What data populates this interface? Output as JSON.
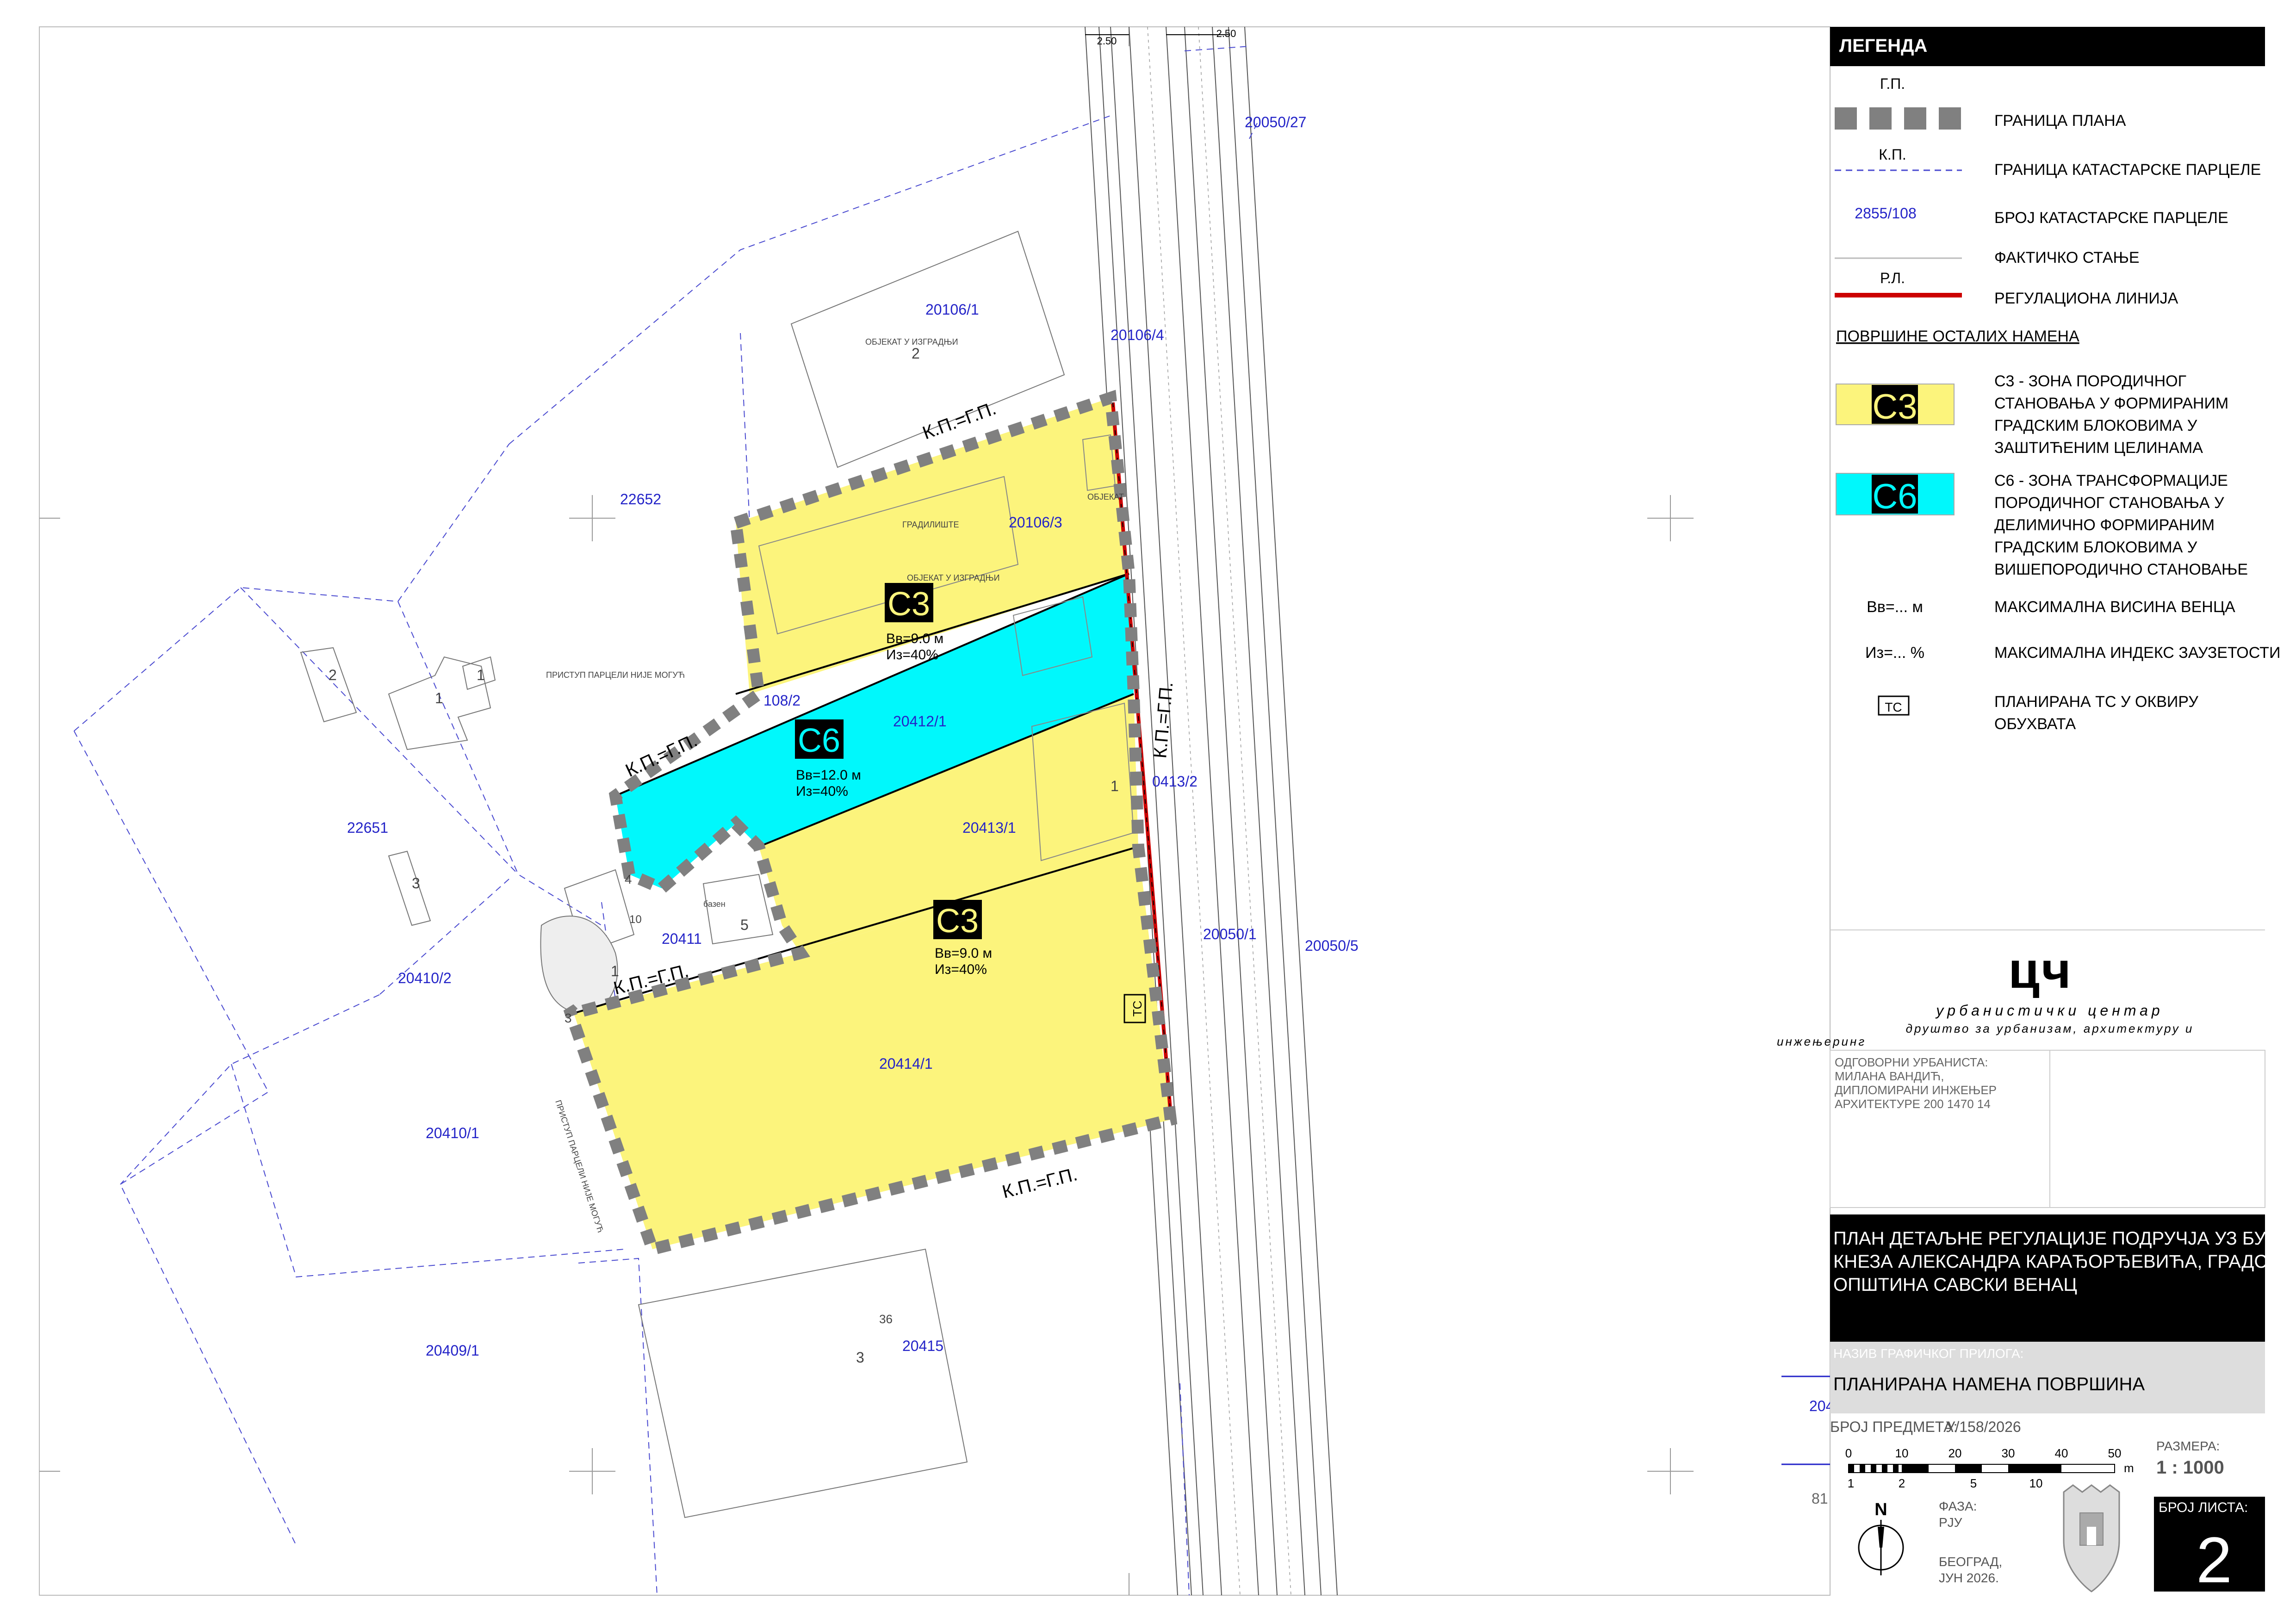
{
  "map": {
    "parcels": [
      {
        "id": "p1",
        "label": "20050/27"
      },
      {
        "id": "p2",
        "label": "20106/1"
      },
      {
        "id": "p3",
        "label": "20106/4"
      },
      {
        "id": "p4",
        "label": "22652"
      },
      {
        "id": "p5",
        "label": "20106/3"
      },
      {
        "id": "p6",
        "label": "108/2"
      },
      {
        "id": "p7",
        "label": "20412/1"
      },
      {
        "id": "p8",
        "label": "0413/2"
      },
      {
        "id": "p9",
        "label": "20413/1"
      },
      {
        "id": "p10",
        "label": "22651"
      },
      {
        "id": "p11",
        "label": "20411"
      },
      {
        "id": "p12",
        "label": "20050/1"
      },
      {
        "id": "p13",
        "label": "20050/5"
      },
      {
        "id": "p14",
        "label": "20410/2"
      },
      {
        "id": "p15",
        "label": "20414/1"
      },
      {
        "id": "p16",
        "label": "20410/1"
      },
      {
        "id": "p17",
        "label": "20409/1"
      },
      {
        "id": "p18",
        "label": "20415"
      },
      {
        "id": "p19",
        "label": "204"
      }
    ],
    "boundary_marks": {
      "kp_gp": "К.П.=Г.П.",
      "road_width": "2.50"
    },
    "zones": {
      "c3_top": {
        "code": "С3",
        "height": "Вв=9.0 м",
        "index": "Из=40%"
      },
      "c6": {
        "code": "С6",
        "height": "Вв=12.0 м",
        "index": "Из=40%"
      },
      "c3_bottom": {
        "code": "С3",
        "height": "Вв=9.0 м",
        "index": "Из=40%"
      }
    },
    "building_labels": {
      "b1": "ОБЈЕКАТ У ИЗГРАДЊИ",
      "b1_num": "2",
      "b2": "ГРАДИЛИШТЕ",
      "b3": "ОБЈЕКАТ У ИЗГРАДЊИ",
      "b4": "ОБЈЕКАТ",
      "access": "ПРИСТУП ПАРЦЕЛИ НИЈЕ МОГУЋ",
      "access2": "ПРИСТУП ПАРЦЕЛИ НИЈЕ МОГУЋ",
      "pool": "базен",
      "n1": "1",
      "n2": "2",
      "n3": "3",
      "n4": "4",
      "n5": "5",
      "n10": "10",
      "n36": "36",
      "n3b": "3",
      "n1b": "1",
      "n3c": "3",
      "n1c": "1"
    },
    "ts": "ТС",
    "sheet_fragment": "81"
  },
  "legend": {
    "title": "ЛЕГЕНДА",
    "gp": "Г.П.",
    "plan_boundary": "ГРАНИЦА ПЛАНА",
    "kp": "К.П.",
    "cadastral_boundary": "ГРАНИЦА КАТАСТАРСКЕ ПАРЦЕЛЕ",
    "parcel_sample": "2855/108",
    "parcel_number": "БРОЈ КАТАСТАРСКЕ ПАРЦЕЛЕ",
    "actual": "ФАКТИЧКО СТАЊЕ",
    "rl": "Р.Л.",
    "regulation_line": "РЕГУЛАЦИОНА ЛИНИЈА",
    "other_uses": "ПОВРШИНЕ ОСТАЛИХ НАМЕНА",
    "c3_code": "С3",
    "c3_desc": [
      "С3 - ЗОНА ПОРОДИЧНОГ",
      "СТАНОВАЊА У ФОРМИРАНИМ",
      "ГРАДСКИМ БЛОКОВИМА У",
      "ЗАШТИЋЕНИМ ЦЕЛИНАМА"
    ],
    "c6_code": "С6",
    "c6_desc": [
      "С6 - ЗОНА ТРАНСФОРМАЦИЈЕ",
      "ПОРОДИЧНОГ СТАНОВАЊА У",
      "ДЕЛИМИЧНО ФОРМИРАНИМ",
      "ГРАДСКИМ БЛОКОВИМА У",
      "ВИШЕПОРОДИЧНО СТАНОВАЊЕ"
    ],
    "vv_sym": "Вв=... м",
    "vv_desc": "МАКСИМАЛНА ВИСИНА ВЕНЦА",
    "iz_sym": "Из=... %",
    "iz_desc": "МАКСИМАЛНА ИНДЕКС ЗАУЗЕТОСТИ",
    "ts_sym": "ТС",
    "ts_desc": [
      "ПЛАНИРАНА ТС У ОКВИРУ",
      "ОБУХВАТА"
    ],
    "colors": {
      "c3": "#fcf47c",
      "c6": "#00f8fc",
      "boundary": "#808080",
      "regulation": "#cc0000",
      "parcel_text": "#2323c8"
    }
  },
  "titleblock": {
    "logo_mark": "цч",
    "org_line1": "урбанистички центар",
    "org_line2": "друштво за урбанизам, архитектуру и",
    "org_line3": "инжењеринг",
    "resp_title": "ОДГОВОРНИ УРБАНИСТА:",
    "resp_name": "МИЛАНА ВАНДИЋ,",
    "resp_role": "ДИПЛОМИРАНИ ИНЖЕЊЕР",
    "resp_lic": "АРХИТЕКТУРЕ 200 1470 14",
    "plan_title": [
      "ПЛАН ДЕТАЉНЕ РЕГУЛАЦИЈЕ ПОДРУЧЈА УЗ БУЛЕВАР",
      "КНЕЗА АЛЕКСАНДРА КАРАЂОРЂЕВИЋА, ГРАДСКА",
      "ОПШТИНА САВСКИ ВЕНАЦ"
    ],
    "graphic_label": "НАЗИВ ГРАФИЧКОГ ПРИЛОГА:",
    "graphic_name": "ПЛАНИРАНА НАМЕНА ПОВРШИНА",
    "case_label": "БРОЈ ПРЕДМЕТА:",
    "case_no": "У/158/2026",
    "scale_label": "РАЗМЕРА:",
    "scale": "1 : 1000",
    "scale_top": [
      "0",
      "10",
      "20",
      "30",
      "40",
      "50"
    ],
    "scale_bottom": [
      "1",
      "2",
      "5",
      "10"
    ],
    "scale_unit": "m",
    "north": "N",
    "phase_label": "ФАЗА:",
    "phase": "РЈУ",
    "place": "БЕОГРАД,",
    "date": "ЈУН 2026.",
    "sheet_label": "БРОЈ ЛИСТА:",
    "sheet_no": "2"
  }
}
